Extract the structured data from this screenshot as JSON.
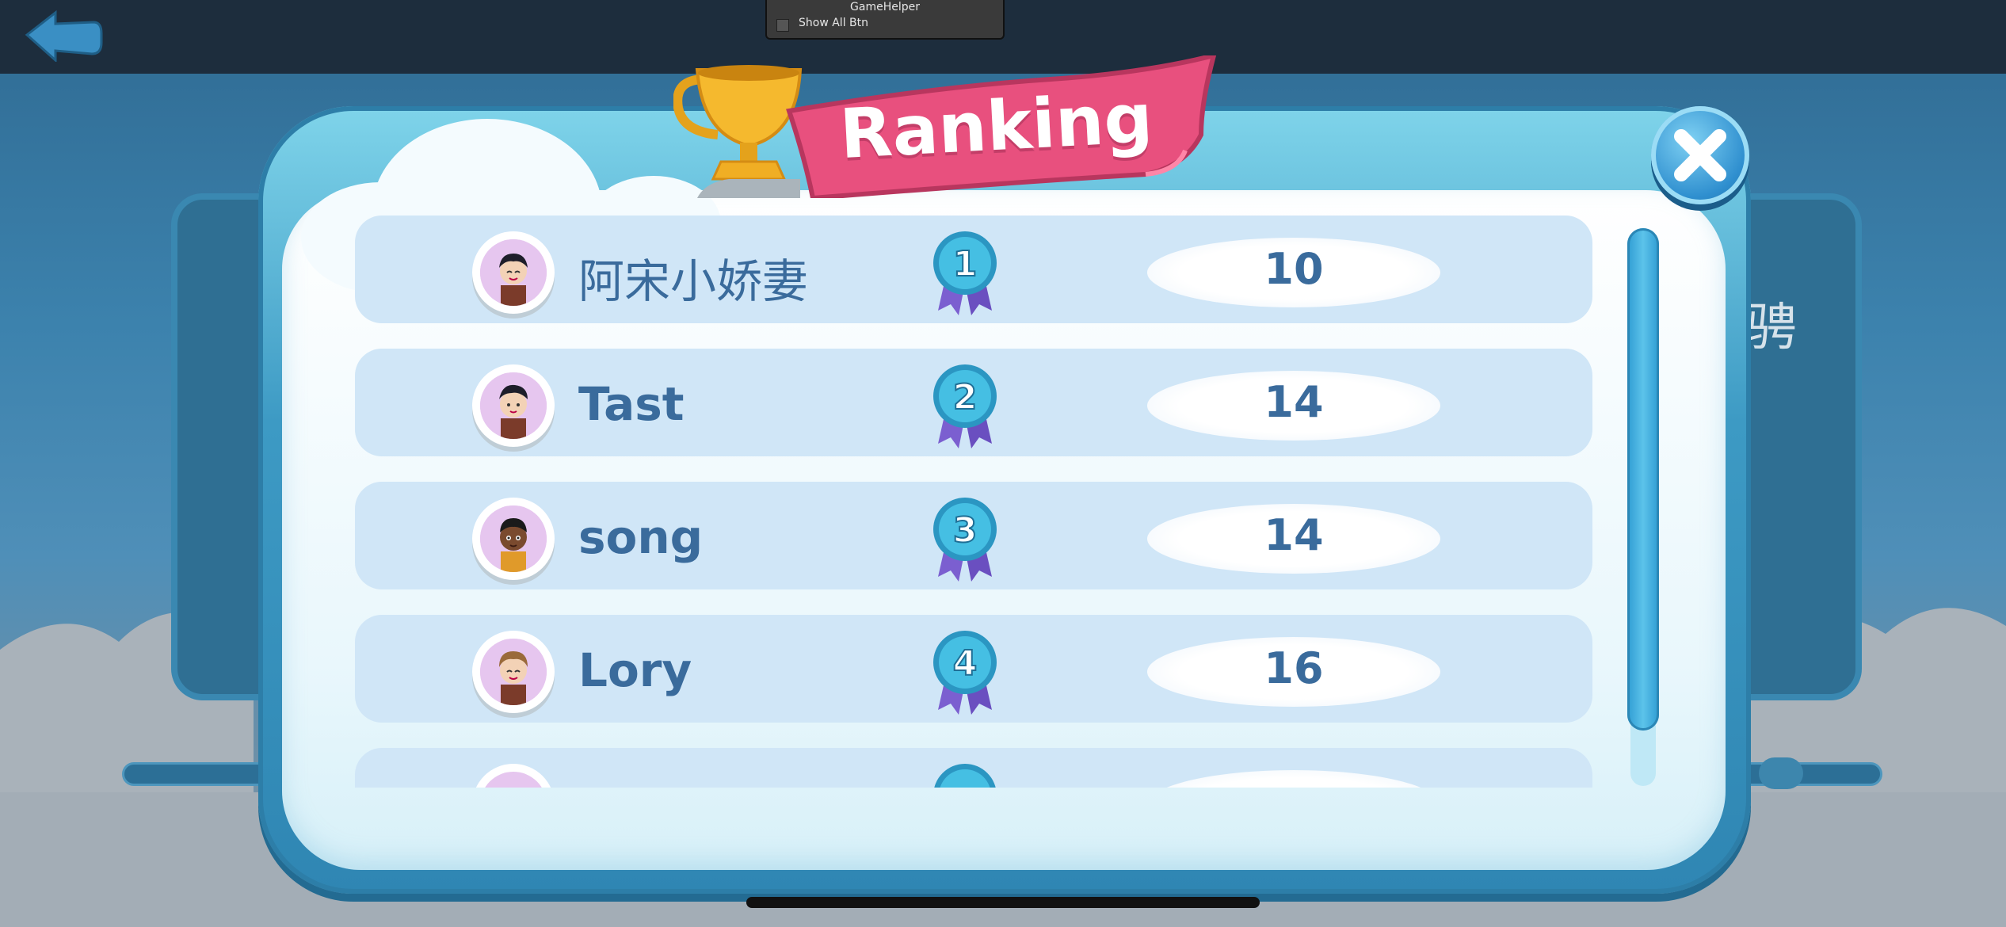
{
  "helper": {
    "title": "GameHelper",
    "toggle_label": "Show All Btn"
  },
  "background": {
    "left_text": "",
    "right_text": "骋"
  },
  "dialog": {
    "title": "Ranking"
  },
  "rows": [
    {
      "name": "阿宋小娇妻",
      "rank": "1",
      "score": "10",
      "avatar": "boy-black-hair-avatar"
    },
    {
      "name": "Tast",
      "rank": "2",
      "score": "14",
      "avatar": "boy-black-hair-avatar"
    },
    {
      "name": "song",
      "rank": "3",
      "score": "14",
      "avatar": "boy-dark-skin-avatar"
    },
    {
      "name": "Lory",
      "rank": "4",
      "score": "16",
      "avatar": "boy-brown-hair-avatar"
    }
  ],
  "colors": {
    "row_bg": "#d0e6f7",
    "text": "#3a6b9c",
    "banner": "#e8507e",
    "medal": "#3fb6dc",
    "ribbon": "#7b5fd0"
  }
}
